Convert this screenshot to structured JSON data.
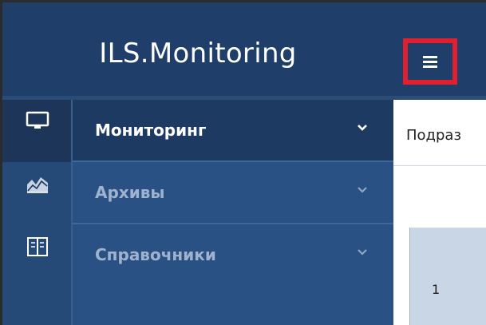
{
  "header": {
    "title": "ILS.Monitoring",
    "menu_icon": "hamburger-menu-icon",
    "highlight_color": "#e0202e"
  },
  "rail": {
    "icons": [
      "monitor-icon",
      "chart-icon",
      "book-icon"
    ]
  },
  "nav": {
    "items": [
      {
        "label": "Мониторинг",
        "active": true
      },
      {
        "label": "Архивы",
        "active": false
      },
      {
        "label": "Справочники",
        "active": false
      }
    ]
  },
  "content": {
    "tab_label": "Подраз",
    "row_number": "1"
  },
  "colors": {
    "header_bg": "#1f3f6a",
    "nav_bg": "#2a5183",
    "nav_active_bg": "#1c3a62"
  }
}
